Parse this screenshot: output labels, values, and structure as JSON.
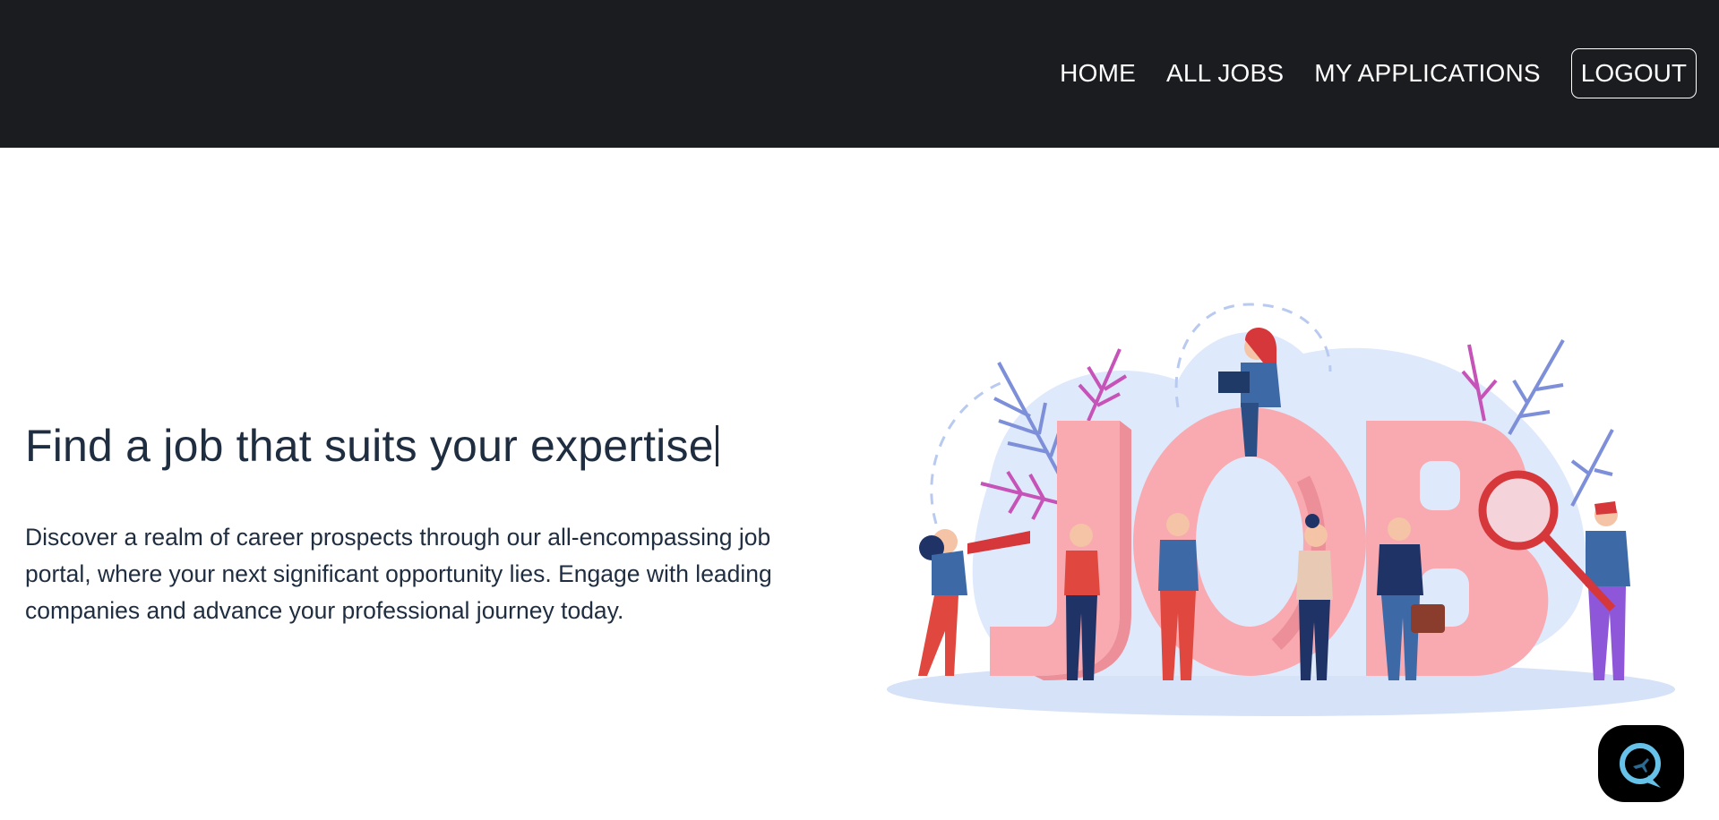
{
  "nav": {
    "items": [
      {
        "label": "HOME"
      },
      {
        "label": "ALL JOBS"
      },
      {
        "label": "MY APPLICATIONS"
      }
    ],
    "logout_label": "LOGOUT"
  },
  "hero": {
    "headline": "Find a job that suits your expertise",
    "description": "Discover a realm of career prospects through our all-encompassing job portal, where your next significant opportunity lies. Engage with leading companies and advance your professional journey today.",
    "illustration_word": "JOB"
  },
  "colors": {
    "topbar": "#1b1c20",
    "text": "#1f2d40",
    "letters": "#f8aab0",
    "blob": "#dbe6fb",
    "accent_red": "#e0483f",
    "accent_blue": "#2d5a9a"
  },
  "icons": {
    "chat": "chat-bubble-icon"
  }
}
